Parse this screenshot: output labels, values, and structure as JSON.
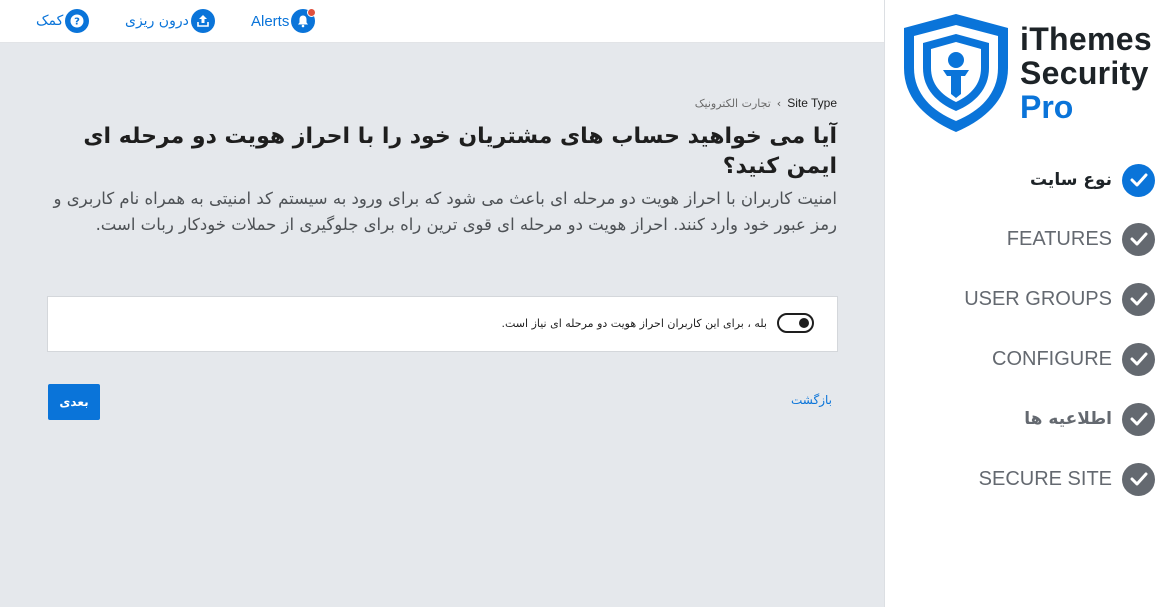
{
  "topbar": {
    "help_label": "کمک",
    "help_icon": "question-icon",
    "import_label": "درون ریزی",
    "import_icon": "upload-icon",
    "alerts_label": "Alerts",
    "alerts_icon": "bell-icon"
  },
  "breadcrumb": {
    "previous": "تجارت الکترونیک",
    "current": "Site Type"
  },
  "main": {
    "title": "آیا می خواهید حساب های مشتریان خود را با احراز هویت دو مرحله ای ایمن کنید؟",
    "description": "امنیت کاربران با احراز هویت دو مرحله ای باعث می شود که برای ورود به سیستم کد امنیتی به همراه نام کاربری و رمز عبور خود وارد کنند. احراز هویت دو مرحله ای قوی ترین راه برای جلوگیری از حملات خودکار ربات است.",
    "option": {
      "label": "بله ، برای این کاربران احراز هویت دو مرحله ای نیاز است.",
      "enabled": true
    },
    "next_label": "بعدی",
    "back_label": "بازگشت"
  },
  "logo": {
    "line1": "iThemes",
    "line2": "Security",
    "line3": "Pro"
  },
  "steps": [
    {
      "label": "نوع سایت",
      "active": true
    },
    {
      "label": "FEATURES",
      "active": false
    },
    {
      "label": "USER GROUPS",
      "active": false
    },
    {
      "label": "CONFIGURE",
      "active": false
    },
    {
      "label": "اطلاعیه ها",
      "active": false
    },
    {
      "label": "SECURE SITE",
      "active": false
    }
  ],
  "colors": {
    "accent": "#0a74d9",
    "step_inactive": "#646970",
    "main_bg": "#e5e8ec",
    "alert_dot": "#e0503d"
  }
}
